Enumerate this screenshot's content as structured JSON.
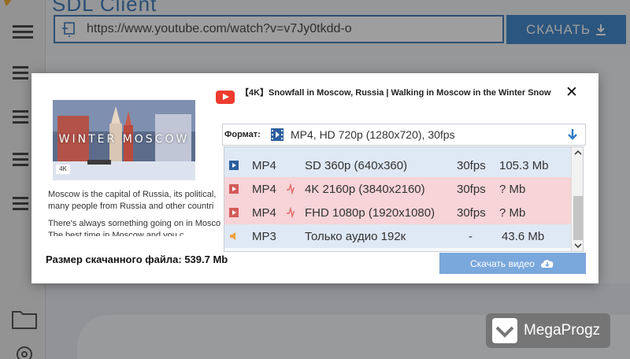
{
  "app": {
    "title": "SDL Client",
    "url": "https://www.youtube.com/watch?v=v7Jy0tkdd-o",
    "download_label": "СКАЧАТЬ"
  },
  "dialog": {
    "video_title": "【4K】Snowfall in Moscow, Russia | Walking in Moscow in the Winter Snow",
    "thumbnail_text": "WINTER MOSCOW",
    "thumbnail_badge": "4K",
    "description": [
      "Moscow is the capital of Russia, its political,",
      "many people from Russia and other countri",
      "There's always something going on in Mosco",
      "The best time in Moscow and you c"
    ],
    "file_size_label": "Размер скачанного файла: 539.7 Mb",
    "format_label": "Формат:",
    "format_value": "MP4, HD 720p (1280x720), 30fps",
    "formats": [
      {
        "type": "MP4",
        "resolution": "SD 360p (640x360)",
        "fps": "30fps",
        "size": "105.3 Mb",
        "kind": "video",
        "highlight": "blue",
        "hd": false
      },
      {
        "type": "MP4",
        "resolution": "4K 2160p (3840x2160)",
        "fps": "30fps",
        "size": "? Mb",
        "kind": "video",
        "highlight": "red",
        "hd": true
      },
      {
        "type": "MP4",
        "resolution": "FHD 1080p (1920x1080)",
        "fps": "30fps",
        "size": "? Mb",
        "kind": "video",
        "highlight": "red",
        "hd": true
      },
      {
        "type": "MP3",
        "resolution": "Только аудио 192к",
        "fps": "-",
        "size": "43.6 Mb",
        "kind": "audio",
        "highlight": "blue",
        "hd": false
      }
    ],
    "download_button": "Скачать видео"
  },
  "watermark": {
    "text": "MegaProgz"
  },
  "colors": {
    "accent": "#2f7cc6",
    "hd_row": "#f6d4d7",
    "selected_row": "#dfe8f5",
    "youtube_red": "#ec3b2f"
  }
}
